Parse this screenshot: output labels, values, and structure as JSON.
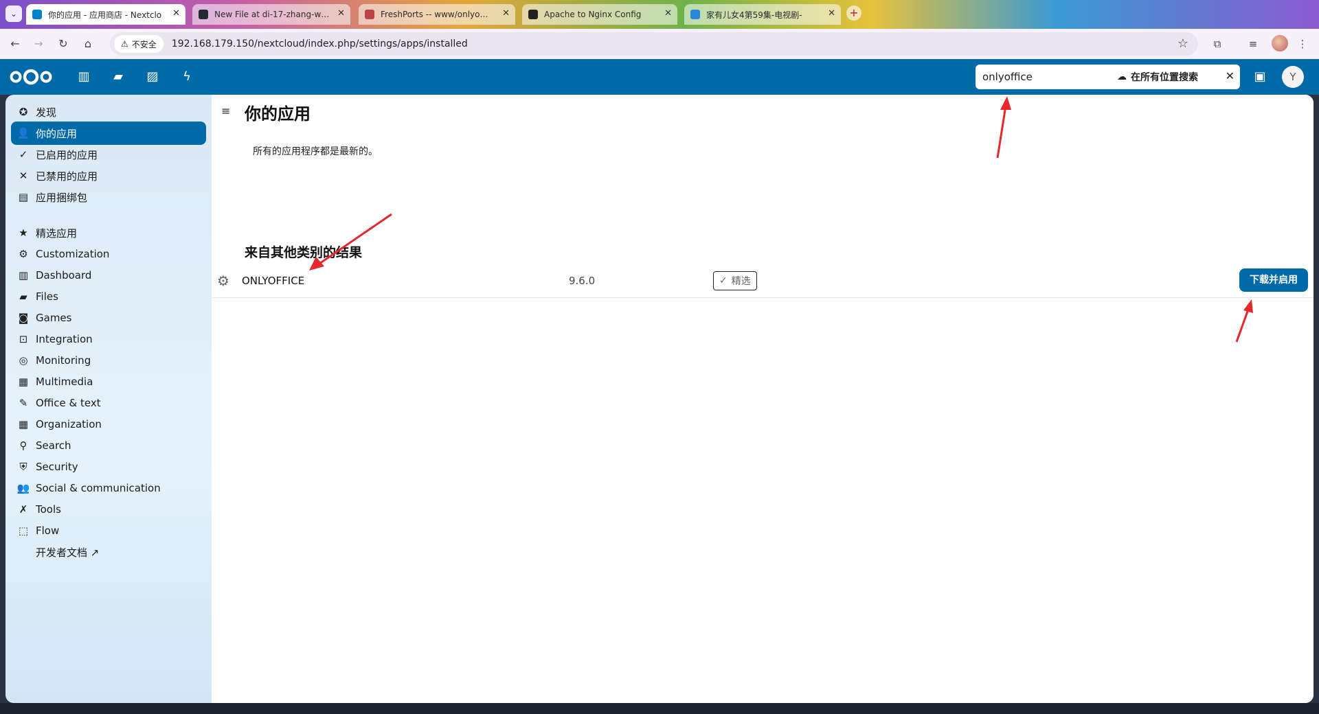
{
  "browser": {
    "tabs": [
      {
        "title": "你的应用 - 应用商店 - Nextclo",
        "active": true,
        "favicon_color": "#0082c9"
      },
      {
        "title": "New File at di-17-zhang-wan",
        "active": false,
        "favicon_color": "#24292f"
      },
      {
        "title": "FreshPorts -- www/onlyoffice",
        "active": false,
        "favicon_color": "#b44"
      },
      {
        "title": "Apache to Nginx Config",
        "active": false,
        "favicon_color": "#222"
      },
      {
        "title": "家有儿女4第59集-电视剧-",
        "active": false,
        "favicon_color": "#2b88d8"
      }
    ],
    "security_label": "不安全",
    "url": "192.168.179.150/nextcloud/index.php/settings/apps/installed"
  },
  "header": {
    "search_value": "onlyoffice",
    "search_scope": "在所有位置搜索",
    "avatar_letter": "Y"
  },
  "sidebar": {
    "items": [
      {
        "label": "发现",
        "icon": "star-circle-icon",
        "glyph": "✪"
      },
      {
        "label": "你的应用",
        "icon": "account-icon",
        "glyph": "👤",
        "active": true
      },
      {
        "label": "已启用的应用",
        "icon": "check-icon",
        "glyph": "✓"
      },
      {
        "label": "已禁用的应用",
        "icon": "close-icon",
        "glyph": "✕"
      },
      {
        "label": "应用捆绑包",
        "icon": "archive-icon",
        "glyph": "▤"
      },
      {
        "label": "精选应用",
        "icon": "star-icon",
        "glyph": "★"
      },
      {
        "label": "Customization",
        "icon": "cog-icon",
        "glyph": "⚙"
      },
      {
        "label": "Dashboard",
        "icon": "dashboard-icon",
        "glyph": "▥"
      },
      {
        "label": "Files",
        "icon": "folder-icon",
        "glyph": "▰"
      },
      {
        "label": "Games",
        "icon": "gamepad-icon",
        "glyph": "◙"
      },
      {
        "label": "Integration",
        "icon": "integration-icon",
        "glyph": "⊡"
      },
      {
        "label": "Monitoring",
        "icon": "monitor-icon",
        "glyph": "◎"
      },
      {
        "label": "Multimedia",
        "icon": "multimedia-icon",
        "glyph": "▦"
      },
      {
        "label": "Office & text",
        "icon": "document-icon",
        "glyph": "✎"
      },
      {
        "label": "Organization",
        "icon": "organization-icon",
        "glyph": "▦"
      },
      {
        "label": "Search",
        "icon": "search-icon",
        "glyph": "⚲"
      },
      {
        "label": "Security",
        "icon": "shield-icon",
        "glyph": "⛨"
      },
      {
        "label": "Social & communication",
        "icon": "people-icon",
        "glyph": "👥"
      },
      {
        "label": "Tools",
        "icon": "tools-icon",
        "glyph": "✗"
      },
      {
        "label": "Flow",
        "icon": "flow-icon",
        "glyph": "⬚"
      },
      {
        "label": "开发者文档 ↗",
        "icon": "",
        "glyph": ""
      }
    ]
  },
  "content": {
    "title": "你的应用",
    "update_message": "所有的应用程序都是最新的。",
    "section_title": "来自其他类别的结果",
    "app": {
      "name": "ONLYOFFICE",
      "version": "9.6.0",
      "badge": "精选",
      "action": "下载并启用"
    }
  },
  "colors": {
    "primary": "#0069a8",
    "annotation_arrow": "#e8262b"
  }
}
